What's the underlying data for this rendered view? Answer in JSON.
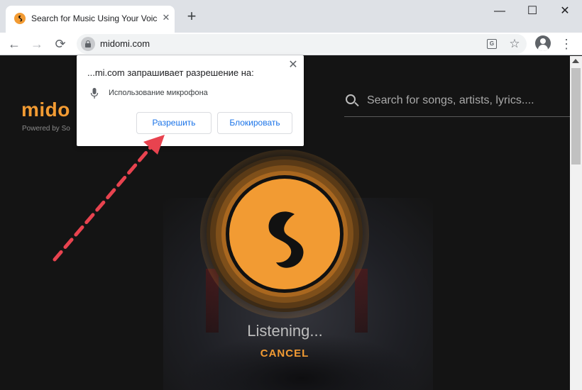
{
  "browser": {
    "tab_title": "Search for Music Using Your Voice",
    "tab_close": "✕",
    "new_tab": "+",
    "window_controls": {
      "minimize": "—",
      "maximize": "☐",
      "close": "✕"
    },
    "nav": {
      "back": "←",
      "forward": "→",
      "reload": "⟳"
    },
    "url": "midomi.com",
    "star": "☆",
    "menu": "⋮"
  },
  "page": {
    "logo": "mido",
    "powered_by": "Powered by So",
    "search": {
      "placeholder": "Search for songs, artists, lyrics...."
    },
    "status": "Listening...",
    "cancel": "CANCEL"
  },
  "popup": {
    "title": "...mi.com запрашивает разрешение на:",
    "permission": "Использование микрофона",
    "allow": "Разрешить",
    "block": "Блокировать",
    "close": "✕"
  },
  "colors": {
    "accent": "#f29b33",
    "annotation_arrow": "#e8434f",
    "page_background": "#141414"
  },
  "icons": [
    "soundhound-favicon",
    "lock-icon",
    "translate-icon",
    "star-icon",
    "account-icon",
    "menu-icon",
    "microphone-icon",
    "search-icon",
    "soundhound-logo-icon",
    "annotation-arrow"
  ]
}
